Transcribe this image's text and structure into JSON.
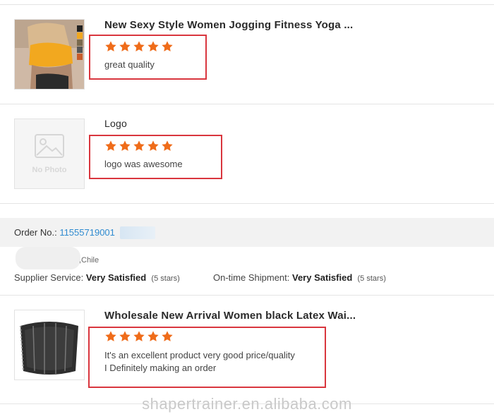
{
  "reviews": [
    {
      "product_title": "New Sexy Style Women Jogging Fitness Yoga ...",
      "rating": 5,
      "review_text": "great quality"
    },
    {
      "product_title": "Logo",
      "rating": 5,
      "thumb_placeholder": "No Photo",
      "review_text": "logo was awesome"
    }
  ],
  "order": {
    "label": "Order No.:",
    "number": "11555719001",
    "address_suffix": ",Chile",
    "supplier_service_label": "Supplier Service:",
    "supplier_service_value": "Very Satisfied",
    "supplier_service_stars": "(5 stars)",
    "shipment_label": "On-time Shipment:",
    "shipment_value": "Very Satisfied",
    "shipment_stars": "(5 stars)",
    "item": {
      "product_title": "Wholesale New Arrival Women black Latex Wai...",
      "rating": 5,
      "review_line1": "It's an excellent product very good price/quality",
      "review_line2": "I Definitely making an order"
    }
  },
  "watermark": "shapertrainer.en.alibaba.com",
  "colors": {
    "star": "#ef6c1a",
    "highlight": "#d9363e",
    "order_number": "#2f8bd0"
  }
}
